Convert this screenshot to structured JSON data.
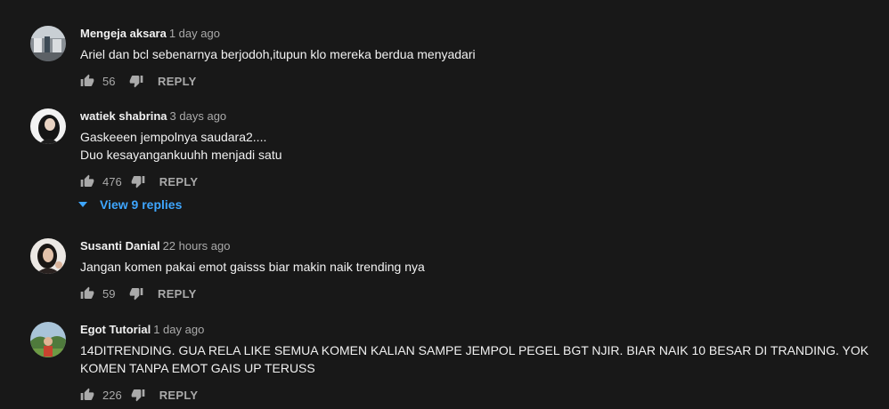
{
  "colors": {
    "background": "#181818",
    "text_primary": "#f1f1f1",
    "text_secondary": "#aaaaaa",
    "link_blue": "#3ea6ff"
  },
  "comments": [
    {
      "author": "Mengeja aksara",
      "time": "1 day ago",
      "lines": [
        "Ariel dan bcl sebenarnya berjodoh,itupun klo mereka berdua menyadari"
      ],
      "likes": "56",
      "reply_label": "REPLY",
      "avatar_icon": "avatar-photo-icon"
    },
    {
      "author": "watiek shabrina",
      "time": "3 days ago",
      "lines": [
        "Gaskeeen jempolnya saudara2....",
        "Duo kesayangankuuhh menjadi satu"
      ],
      "likes": "476",
      "reply_label": "REPLY",
      "view_replies": "View 9 replies",
      "avatar_icon": "avatar-photo-icon"
    },
    {
      "author": "Susanti Danial",
      "time": "22 hours ago",
      "lines": [
        "Jangan komen pakai emot gaisss biar makin naik trending nya"
      ],
      "likes": "59",
      "reply_label": "REPLY",
      "avatar_icon": "avatar-photo-icon"
    },
    {
      "author": "Egot Tutorial",
      "time": "1 day ago",
      "lines": [
        "14DITRENDING. GUA RELA LIKE SEMUA KOMEN KALIAN SAMPE JEMPOL PEGEL BGT NJIR. BIAR NAIK 10 BESAR DI TRANDING. YOK KOMEN TANPA EMOT GAIS UP TERUSS"
      ],
      "likes": "226",
      "reply_label": "REPLY",
      "avatar_icon": "avatar-photo-icon"
    }
  ]
}
